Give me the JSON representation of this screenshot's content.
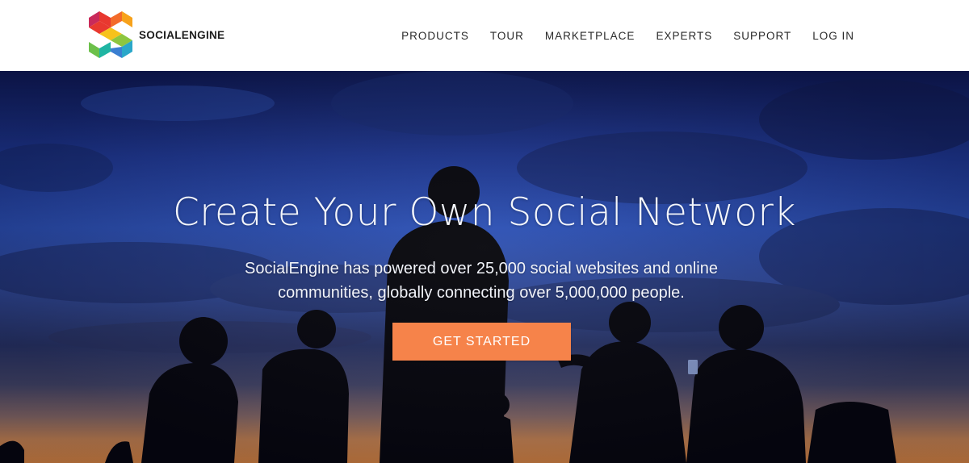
{
  "header": {
    "brand": "SOCIALENGINE",
    "logo_icon": "socialengine-s-logo",
    "nav": [
      {
        "label": "PRODUCTS"
      },
      {
        "label": "TOUR"
      },
      {
        "label": "MARKETPLACE"
      },
      {
        "label": "EXPERTS"
      },
      {
        "label": "SUPPORT"
      },
      {
        "label": "LOG IN"
      }
    ]
  },
  "hero": {
    "title": "Create Your Own Social Network",
    "subtitle": "SocialEngine has powered over 25,000 social websites and online communities, globally connecting over 5,000,000 people.",
    "cta_label": "GET STARTED",
    "background_image": "silhouettes-of-people-at-dusk"
  },
  "colors": {
    "cta": "#f6834a",
    "header_bg": "#ffffff",
    "nav_text": "#2a2a2a",
    "sky_top": "#0f1a55",
    "sky_horizon": "#e08a42"
  }
}
